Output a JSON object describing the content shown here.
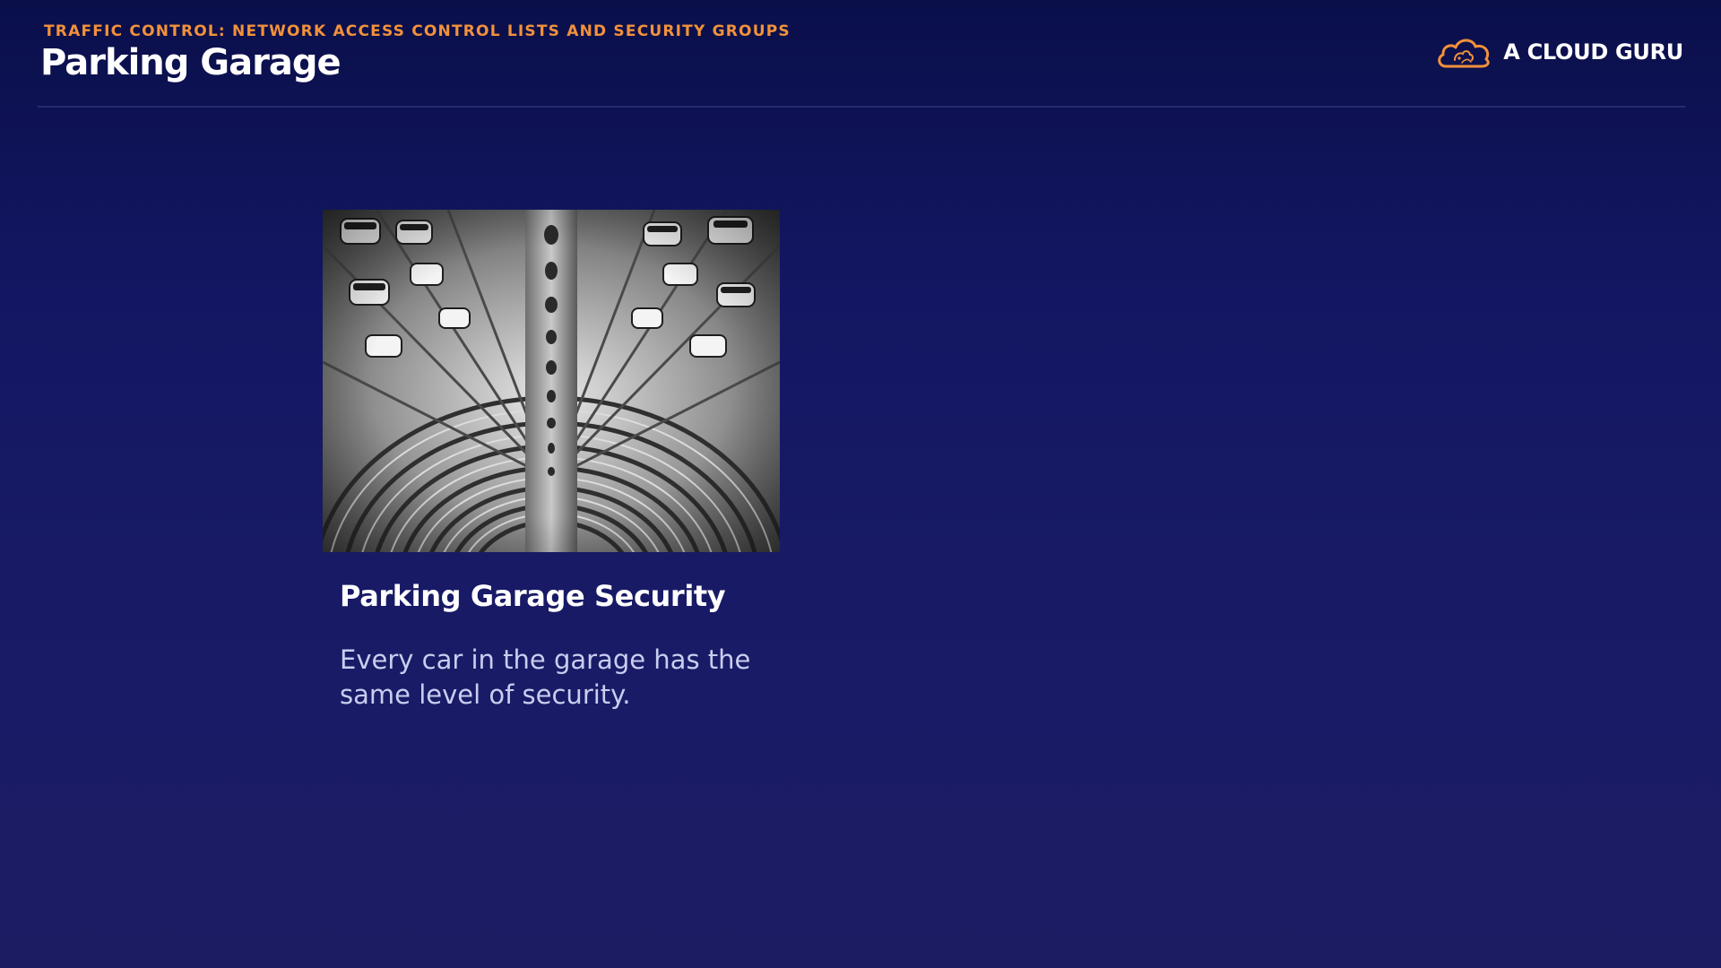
{
  "header": {
    "kicker": "TRAFFIC CONTROL: NETWORK ACCESS CONTROL LISTS AND SECURITY GROUPS",
    "title": "Parking Garage"
  },
  "brand": {
    "name": "A CLOUD GURU",
    "icon": "cloud-logo-icon",
    "accent_color": "#f2913b"
  },
  "card": {
    "image_icon": "parking-garage-photo",
    "heading": "Parking Garage Security",
    "body": "Every car in the garage has the same level of security."
  },
  "colors": {
    "background_top": "#0a0f4a",
    "background_bottom": "#1c1c63",
    "kicker": "#f2913b",
    "body_text": "#c9cdf0"
  }
}
